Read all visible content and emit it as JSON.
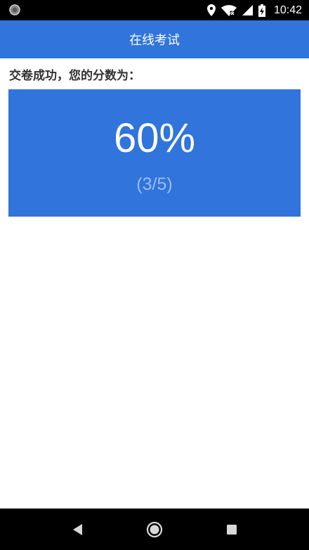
{
  "status_bar": {
    "time": "10:42",
    "icons": [
      "notification-circle-icon",
      "location-icon",
      "wifi-off-icon",
      "signal-icon",
      "battery-charging-icon"
    ]
  },
  "app_bar": {
    "title": "在线考试"
  },
  "result": {
    "prompt": "交卷成功，您的分数为：",
    "percent": "60%",
    "fraction": "(3/5)",
    "score": 3,
    "total": 5
  },
  "nav_bar": {
    "icons": [
      "back-icon",
      "home-icon",
      "recents-icon"
    ]
  },
  "colors": {
    "accent": "#3074dc",
    "fraction_text": "#9dbcf0",
    "prompt_text": "#333333",
    "system_bars": "#000000"
  }
}
